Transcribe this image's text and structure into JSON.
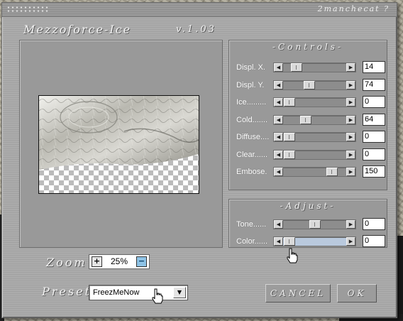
{
  "window": {
    "title": "Mezzoforce-Ice",
    "version": "v.1.03",
    "signature": "2manchecat ?"
  },
  "controls": {
    "title": "-Controls-",
    "sliders": [
      {
        "label": "Displ. X.",
        "value": "14",
        "fraction": 0.14
      },
      {
        "label": "Displ. Y.",
        "value": "74",
        "fraction": 0.4
      },
      {
        "label": "Ice.........",
        "value": "0",
        "fraction": 0.0
      },
      {
        "label": "Cold.......",
        "value": "64",
        "fraction": 0.32
      },
      {
        "label": "Diffuse....",
        "value": "0",
        "fraction": 0.0
      },
      {
        "label": "Clear......",
        "value": "0",
        "fraction": 0.0
      },
      {
        "label": "Embose.",
        "value": "150",
        "fraction": 0.85
      }
    ]
  },
  "adjust": {
    "title": "-Adjust-",
    "sliders": [
      {
        "label": "Tone......",
        "value": "0",
        "fraction": 0.5
      },
      {
        "label": "Color......",
        "value": "0",
        "fraction": 0.0,
        "track_color": "#b9c9dd"
      }
    ]
  },
  "zoom": {
    "label": "Zoom",
    "value": "25%",
    "plus": "+",
    "minus": "−"
  },
  "preset": {
    "label": "Preset",
    "value": "FreezMeNow"
  },
  "buttons": {
    "cancel": "CANCEL",
    "ok": "OK"
  }
}
